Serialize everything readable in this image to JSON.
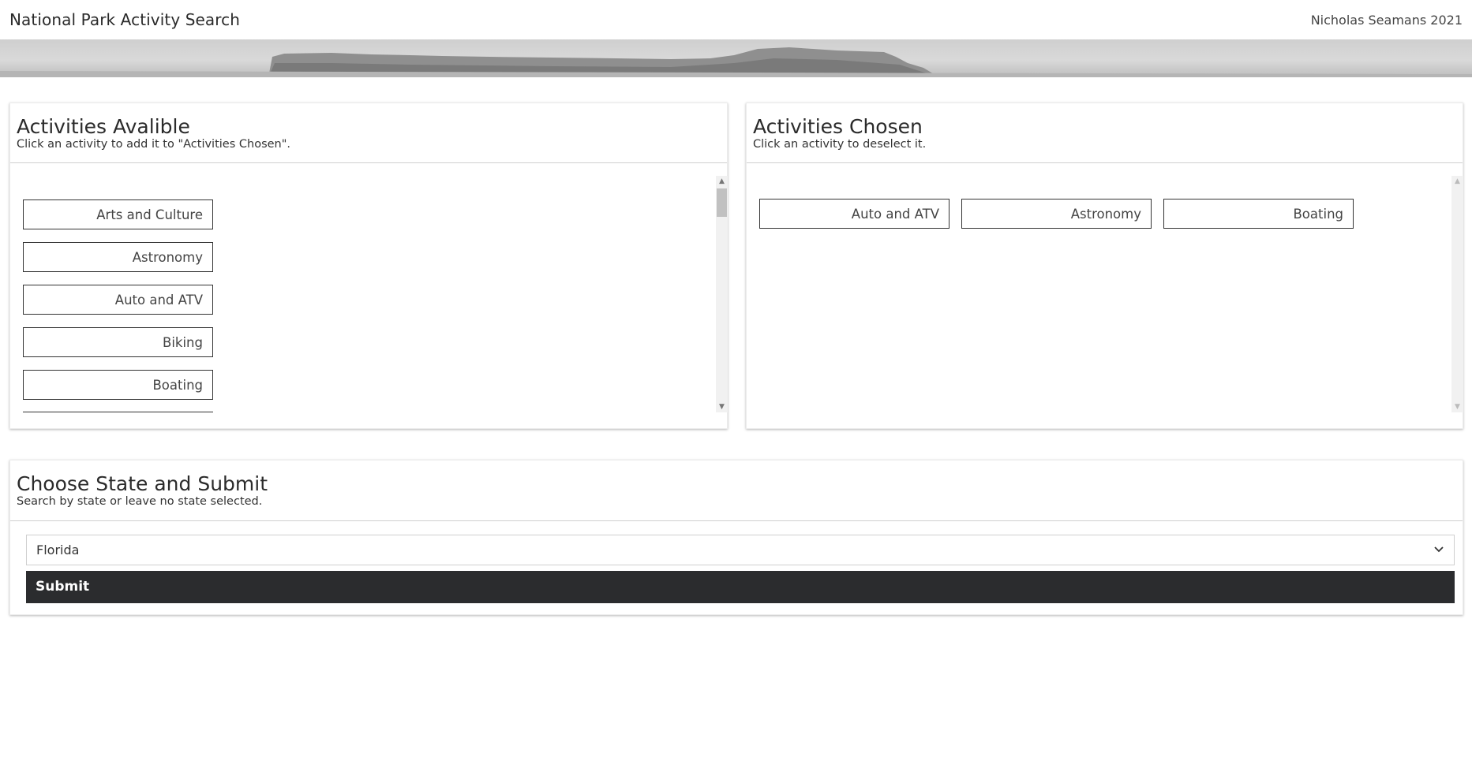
{
  "header": {
    "title": "National Park Activity Search",
    "author": "Nicholas Seamans 2021"
  },
  "available": {
    "title": "Activities Avalible",
    "subtitle": "Click an activity to add it to \"Activities Chosen\".",
    "items": [
      "Arts and Culture",
      "Astronomy",
      "Auto and ATV",
      "Biking",
      "Boating"
    ]
  },
  "chosen": {
    "title": "Activities Chosen",
    "subtitle": "Click an activity to deselect it.",
    "items": [
      "Auto and ATV",
      "Astronomy",
      "Boating"
    ]
  },
  "state": {
    "title": "Choose State and Submit",
    "subtitle": "Search by state or leave no state selected.",
    "selected": "Florida",
    "submit_label": "Submit"
  },
  "icons": {
    "scroll_up": "chevron-up-icon",
    "scroll_down": "chevron-down-icon",
    "select_arrow": "chevron-down-icon"
  }
}
